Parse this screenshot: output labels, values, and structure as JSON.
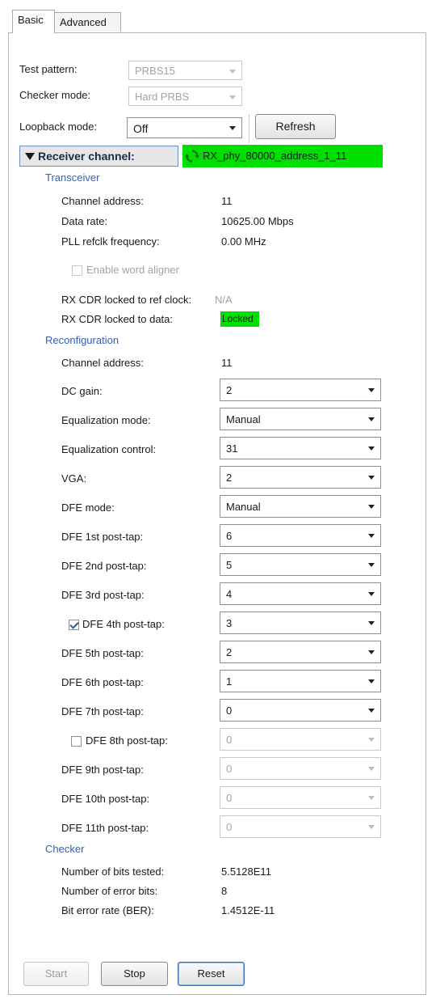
{
  "tabs": [
    "Basic",
    "Advanced"
  ],
  "top": {
    "test_pattern_label": "Test pattern:",
    "test_pattern_value": "PRBS15",
    "checker_mode_label": "Checker mode:",
    "checker_mode_value": "Hard PRBS",
    "loopback_mode_label": "Loopback mode:",
    "loopback_mode_value": "Off",
    "refresh_label": "Refresh"
  },
  "receiver": {
    "header_label": "Receiver channel:",
    "channel_name": "RX_phy_80000_address_1_11"
  },
  "transceiver": {
    "section": "Transceiver",
    "channel_address_label": "Channel address:",
    "channel_address_value": "11",
    "data_rate_label": "Data rate:",
    "data_rate_value": "10625.00 Mbps",
    "pll_label": "PLL refclk frequency:",
    "pll_value": "0.00 MHz",
    "word_aligner_label": "Enable word aligner",
    "cdr_ref_label": "RX CDR locked to ref clock:",
    "cdr_ref_value": "N/A",
    "cdr_data_label": "RX CDR locked to data:",
    "cdr_data_value": "Locked"
  },
  "reconfig": {
    "section": "Reconfiguration",
    "channel_address_label": "Channel address:",
    "channel_address_value": "11",
    "rows": [
      {
        "label": "DC gain:",
        "value": "2"
      },
      {
        "label": "Equalization mode:",
        "value": "Manual"
      },
      {
        "label": "Equalization control:",
        "value": "31"
      },
      {
        "label": "VGA:",
        "value": "2"
      },
      {
        "label": "DFE mode:",
        "value": "Manual"
      },
      {
        "label": "DFE 1st post-tap:",
        "value": "6"
      },
      {
        "label": "DFE 2nd post-tap:",
        "value": "5"
      },
      {
        "label": "DFE 3rd post-tap:",
        "value": "4"
      },
      {
        "label": "DFE 4th post-tap:",
        "value": "3"
      },
      {
        "label": "DFE 5th post-tap:",
        "value": "2"
      },
      {
        "label": "DFE 6th post-tap:",
        "value": "1"
      },
      {
        "label": "DFE 7th post-tap:",
        "value": "0"
      },
      {
        "label": "DFE 8th post-tap:",
        "value": "0"
      },
      {
        "label": "DFE 9th post-tap:",
        "value": "0"
      },
      {
        "label": "DFE 10th post-tap:",
        "value": "0"
      },
      {
        "label": "DFE 11th post-tap:",
        "value": "0"
      }
    ]
  },
  "checker": {
    "section": "Checker",
    "bits_tested_label": "Number of bits tested:",
    "bits_tested_value": "5.5128E11",
    "error_bits_label": "Number of error bits:",
    "error_bits_value": "8",
    "ber_label": "Bit error rate (BER):",
    "ber_value": "1.4512E-11"
  },
  "buttons": {
    "start": "Start",
    "stop": "Stop",
    "reset": "Reset"
  },
  "colors": {
    "highlight_green": "#00e000",
    "section_blue": "#2f5fb8"
  }
}
